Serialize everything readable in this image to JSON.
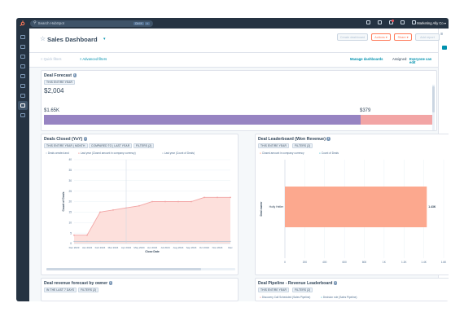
{
  "topnav": {
    "search_placeholder": "Search HubSpot",
    "search_shortcut": "Ctrl K",
    "account_name": "Marketing Ally Co"
  },
  "header": {
    "title": "Sales Dashboard",
    "buttons": [
      "Create dashboard",
      "Actions",
      "Share",
      "Add report"
    ]
  },
  "filterbar": {
    "quick_filters": "Quick filters",
    "advanced_filters": "Advanced filters",
    "manage_dashboards": "Manage dashboards",
    "assigned_label": "Assigned:",
    "assigned_value": "Everyone can edit"
  },
  "deal_forecast": {
    "title": "Deal Forecast",
    "tag": "THIS ENTIRE YEAR",
    "total": "$2,004",
    "left_value": "$1.65K",
    "right_value": "$379",
    "fraction_left": 0.81,
    "colors": {
      "left": "#9784c2",
      "right": "#f2a5a5"
    }
  },
  "deals_closed": {
    "title": "Deals Closed (YoY)",
    "tags": [
      "THIS ENTIRE YEAR | MONTH",
      "COMPARED TO | LAST YEAR",
      "FILTERS (2)"
    ],
    "legend": [
      "Deals created and",
      "Last year (Closed amount in company currency)",
      "Last year (Count of Deals)"
    ],
    "ylabel": "Count of Deals",
    "xlabel": "Close Date",
    "colors": {
      "area": "#fde0dc",
      "line": "#f2a5a5",
      "prev": "#bcc8d6"
    }
  },
  "leaderboard": {
    "title": "Deal Leaderboard (Won Revenue)",
    "tags": [
      "THIS ENTIRE YEAR",
      "FILTERS (2)"
    ],
    "legend": [
      "Closed amount in company currency",
      "Count of Deals"
    ],
    "ylabel": "Deal owner",
    "owner": "Holly Heller",
    "value_label": "1.43K",
    "colors": {
      "bar": "#fca88e"
    }
  },
  "revenue_forecast": {
    "title": "Deal revenue forecast by owner",
    "tags": [
      "IN THE LAST 7 DAYS",
      "FILTERS (2)"
    ]
  },
  "pipeline": {
    "title": "Deal Pipeline - Revenue Leaderboard",
    "tags": [
      "THIS ENTIRE YEAR",
      "FILTERS (2)"
    ],
    "legend": [
      "Discovery Call Scheduled (Sales Pipeline)",
      "Decision role (Sales Pipeline)"
    ]
  },
  "chart_data": [
    {
      "type": "area",
      "title": "Deals Closed (YoY)",
      "xlabel": "Close Date",
      "ylabel": "Count of Deals",
      "categories": [
        "Dec 2023",
        "Jan 2024",
        "Feb 2024",
        "Mar 2024",
        "Apr 2024",
        "May 2024",
        "Jun 2024",
        "Jul 2024",
        "Aug 2024",
        "Sep 2024",
        "Oct 2024",
        "Nov 2024",
        "Dec"
      ],
      "y_ticks": [
        0,
        5,
        10,
        15,
        20,
        25,
        30,
        35,
        40
      ],
      "ylim": [
        0,
        40
      ],
      "series": [
        {
          "values": [
            4,
            4,
            15,
            16,
            17,
            18,
            20,
            20,
            20,
            20,
            22,
            22,
            22
          ]
        },
        {
          "values": [
            1,
            1,
            1,
            1,
            1,
            1,
            1,
            1,
            1,
            1,
            1,
            1,
            1
          ]
        }
      ]
    },
    {
      "type": "bar",
      "title": "Deal Leaderboard (Won Revenue)",
      "ylabel": "Deal owner",
      "categories": [
        "Holly Heller"
      ],
      "x_ticks": [
        "0",
        "200",
        "400",
        "600",
        "800",
        "1K",
        "1.2K",
        "1.4K",
        "1.6K"
      ],
      "xlim": [
        0,
        1600
      ],
      "values": [
        1430
      ]
    }
  ]
}
